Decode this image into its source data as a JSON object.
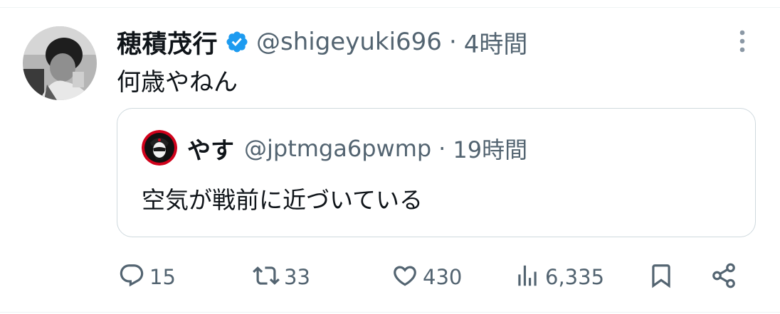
{
  "tweet": {
    "author": {
      "name": "穂積茂行",
      "handle": "@shigeyuki696",
      "verified": true
    },
    "separator": "·",
    "time": "4時間",
    "text": "何歳やねん"
  },
  "quote": {
    "author": {
      "name": "やす",
      "handle": "@jptmga6pwmp"
    },
    "separator": "·",
    "time": "19時間",
    "text": "空気が戦前に近づいている"
  },
  "actions": {
    "replies": "15",
    "retweets": "33",
    "likes": "430",
    "views": "6,335"
  },
  "colors": {
    "verified": "#1d9bf0",
    "secondary_text": "#536471",
    "quote_border": "#cfd9de",
    "quote_avatar_ring": "#d0021b"
  },
  "icons": [
    "verified-badge-icon",
    "more-options-icon",
    "reply-icon",
    "retweet-icon",
    "like-icon",
    "views-icon",
    "bookmark-icon",
    "share-icon"
  ]
}
